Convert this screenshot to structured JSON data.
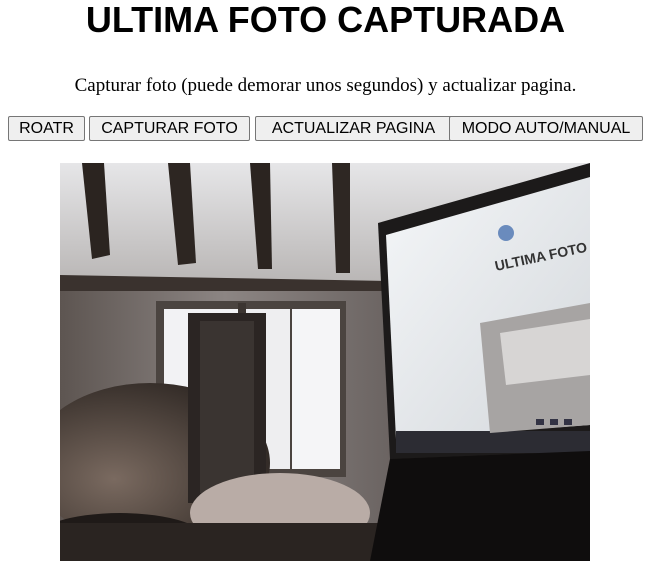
{
  "page": {
    "title": "ULTIMA FOTO CAPTURADA",
    "instructions": "Capturar foto (puede demorar unos segundos) y actualizar pagina."
  },
  "toolbar": {
    "rotate_label": "ROATR",
    "capture_label": "CAPTURAR FOTO",
    "refresh_label": "ACTUALIZAR PAGINA",
    "mode_label": "MODO AUTO/MANUAL"
  },
  "photo": {
    "screen_text": "ULTIMA FOTO"
  }
}
